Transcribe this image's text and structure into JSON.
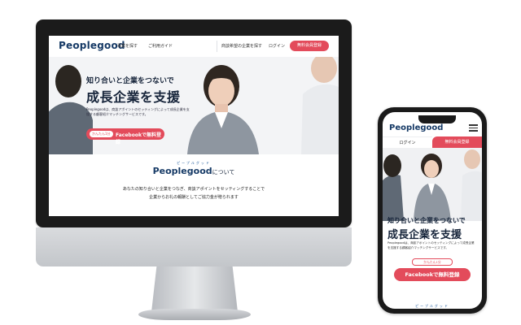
{
  "brand": {
    "name": "Peoplegood",
    "kana": "ピープルグッド",
    "red": "#e34b5b",
    "navy": "#163a66"
  },
  "desktop": {
    "nav": {
      "links": [
        "事業を探す",
        "ご利用ガイド"
      ],
      "right_link": "商談希望の企業を探す",
      "login": "ログイン",
      "register": "無料会員登録"
    },
    "hero": {
      "catch": "知り合いと企業をつないで",
      "headline": "成長企業を支援",
      "description": "Peoplegoodは、商談アポイントのセッティングによって成長企業を支援する顧客紹介マッチングサービスです。",
      "cta_badge": "かんたん1分",
      "cta_label": "Facebookで無料登録"
    },
    "about": {
      "kana": "ピープルグッド",
      "title_brand": "Peoplegood",
      "title_suffix": "について",
      "line1": "あなたの知り合いと企業をつなぎ、商談アポイントをセッティングすることで",
      "line2": "企業からお礼の報酬としてご協力金が贈られます"
    }
  },
  "mobile": {
    "logo": "Peoplegood",
    "menu_icon": "hamburger-icon",
    "login": "ログイン",
    "register": "無料会員登録",
    "catch": "知り合いと企業をつないで",
    "headline": "成長企業を支援",
    "description": "Peoplegoodは、商談アポイントのセッティングによって成長企業を支援する顧客紹介マッチングサービスです。",
    "cta_badge": "かんたん1分",
    "cta_label": "Facebookで無料登録",
    "kana": "ピープルグッド"
  }
}
